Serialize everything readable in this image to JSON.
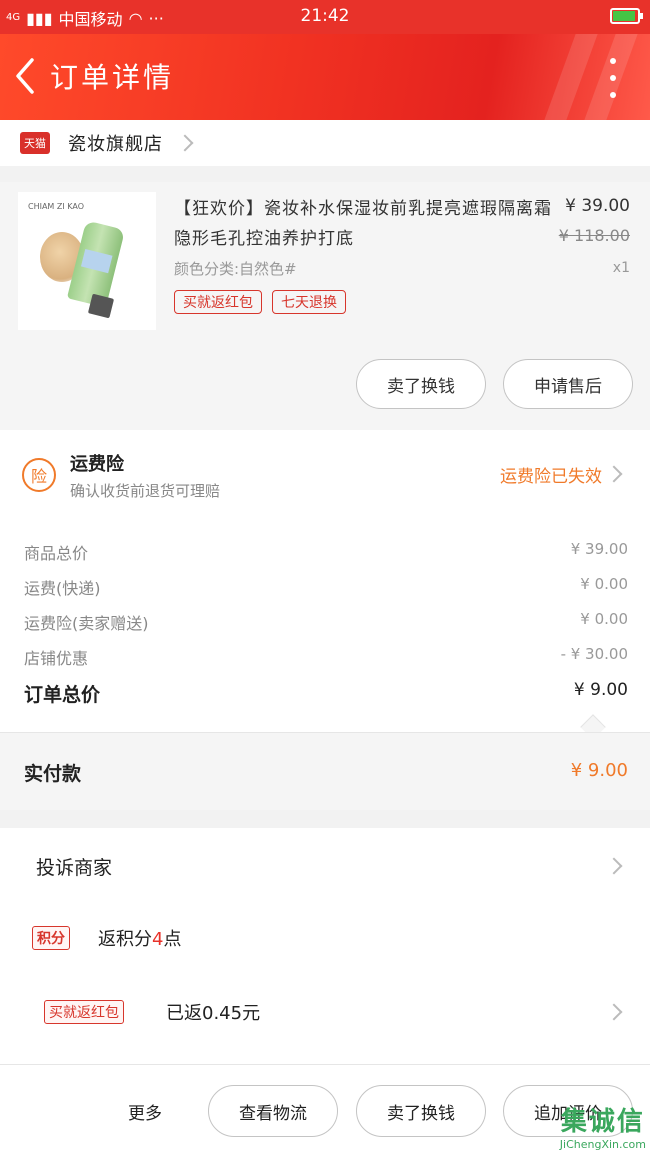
{
  "status_bar": {
    "signal": "4G",
    "carrier": "中国移动",
    "dots": "···",
    "time": "21:42"
  },
  "header": {
    "title": "订单详情"
  },
  "store": {
    "badge": "天猫",
    "name": "瓷妆旗舰店"
  },
  "product": {
    "title": "【狂欢价】瓷妆补水保湿妆前乳提亮遮瑕隔离霜隐形毛孔控油养护打底",
    "sku": "颜色分类:自然色#",
    "price": "¥ 39.00",
    "original_price": "¥ 118.00",
    "quantity": "x1",
    "image_logo": "CHIAM ZI KAO",
    "tags": [
      "买就返红包",
      "七天退换"
    ],
    "buttons": {
      "return": "卖了换钱",
      "after_sale": "申请售后"
    }
  },
  "insurance": {
    "icon": "险",
    "title": "运费险",
    "desc": "确认收货前退货可理赔",
    "status": "运费险已失效"
  },
  "summary": {
    "rows": [
      {
        "label": "商品总价",
        "value": "¥ 39.00"
      },
      {
        "label": "运费(快递)",
        "value": "¥ 0.00"
      },
      {
        "label": "运费险(卖家赠送)",
        "value": "¥ 0.00"
      },
      {
        "label": "店铺优惠",
        "value": "- ¥ 30.00"
      }
    ],
    "total": {
      "label": "订单总价",
      "value": "¥ 9.00"
    }
  },
  "paid": {
    "label": "实付款",
    "value": "¥ 9.00"
  },
  "list": {
    "complain": "投诉商家",
    "points": {
      "badge": "积分",
      "prefix": "返积分",
      "count": "4",
      "suffix": "点"
    },
    "redpacket": {
      "badge": "买就返红包",
      "text": "已返0.45元"
    }
  },
  "bottom_bar": {
    "more": "更多",
    "buttons": [
      "查看物流",
      "卖了换钱",
      "追加评价"
    ]
  },
  "watermark": {
    "text": "集诚信",
    "url": "JiChengXin.com"
  },
  "colors": {
    "accent": "#e8322a",
    "orange": "#f07a2a",
    "tag_red": "#d7362c"
  }
}
